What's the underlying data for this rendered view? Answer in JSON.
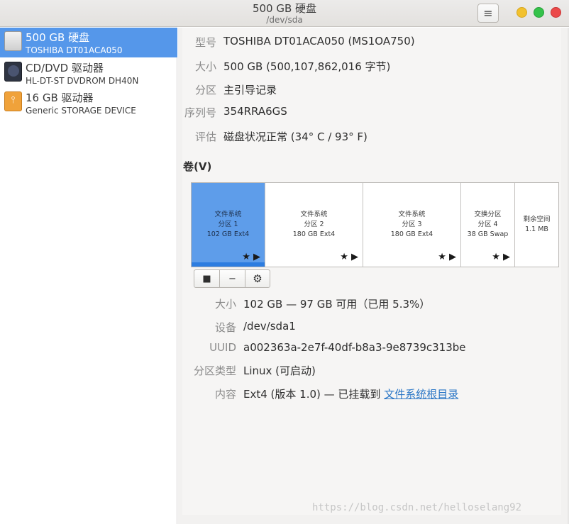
{
  "window": {
    "title": "500 GB 硬盘",
    "subtitle": "/dev/sda",
    "menu_icon": "≡"
  },
  "sidebar": {
    "items": [
      {
        "name": "500 GB 硬盘",
        "model": "TOSHIBA DT01ACA050",
        "icon": "hdd-icon",
        "selected": true
      },
      {
        "name": "CD/DVD 驱动器",
        "model": "HL-DT-ST DVDROM DH40N",
        "icon": "optical-drive-icon",
        "selected": false
      },
      {
        "name": "16 GB 驱动器",
        "model": "Generic STORAGE DEVICE",
        "icon": "usb-drive-icon",
        "selected": false
      }
    ]
  },
  "disk": {
    "model_label": "型号",
    "model_value": "TOSHIBA DT01ACA050 (MS1OA750)",
    "size_label": "大小",
    "size_value": "500 GB (500,107,862,016 字节)",
    "partitioning_label": "分区",
    "partitioning_value": "主引导记录",
    "serial_label": "序列号",
    "serial_value": "354RRA6GS",
    "assessment_label": "评估",
    "assessment_value": "磁盘状况正常 (34° C / 93° F)"
  },
  "volumes_heading": "卷(V)",
  "partitions": [
    {
      "line1": "文件系统",
      "line2": "分区 1",
      "line3": "102 GB Ext4",
      "selected": true,
      "marks": "★ ▶"
    },
    {
      "line1": "文件系统",
      "line2": "分区 2",
      "line3": "180 GB Ext4",
      "selected": false,
      "marks": "★ ▶"
    },
    {
      "line1": "文件系统",
      "line2": "分区 3",
      "line3": "180 GB Ext4",
      "selected": false,
      "marks": "★ ▶"
    },
    {
      "line1": "交换分区",
      "line2": "分区 4",
      "line3": "38 GB Swap",
      "selected": false,
      "marks": "★ ▶"
    },
    {
      "line1": "剩余空间",
      "line2": "1.1 MB",
      "line3": "",
      "selected": false,
      "marks": ""
    }
  ],
  "toolbar": {
    "stop_icon": "■",
    "remove_icon": "−",
    "settings_icon": "⚙"
  },
  "volume": {
    "size_label": "大小",
    "size_value": "102 GB — 97 GB 可用（已用 5.3%）",
    "device_label": "设备",
    "device_value": "/dev/sda1",
    "uuid_label": "UUID",
    "uuid_value": "a002363a-2e7f-40df-b8a3-9e8739c313be",
    "type_label": "分区类型",
    "type_value": "Linux (可启动)",
    "contents_label": "内容",
    "contents_prefix": "Ext4 (版本 1.0) — 已挂载到 ",
    "contents_link": "文件系统根目录"
  },
  "watermark": "https://blog.csdn.net/helloselang92"
}
